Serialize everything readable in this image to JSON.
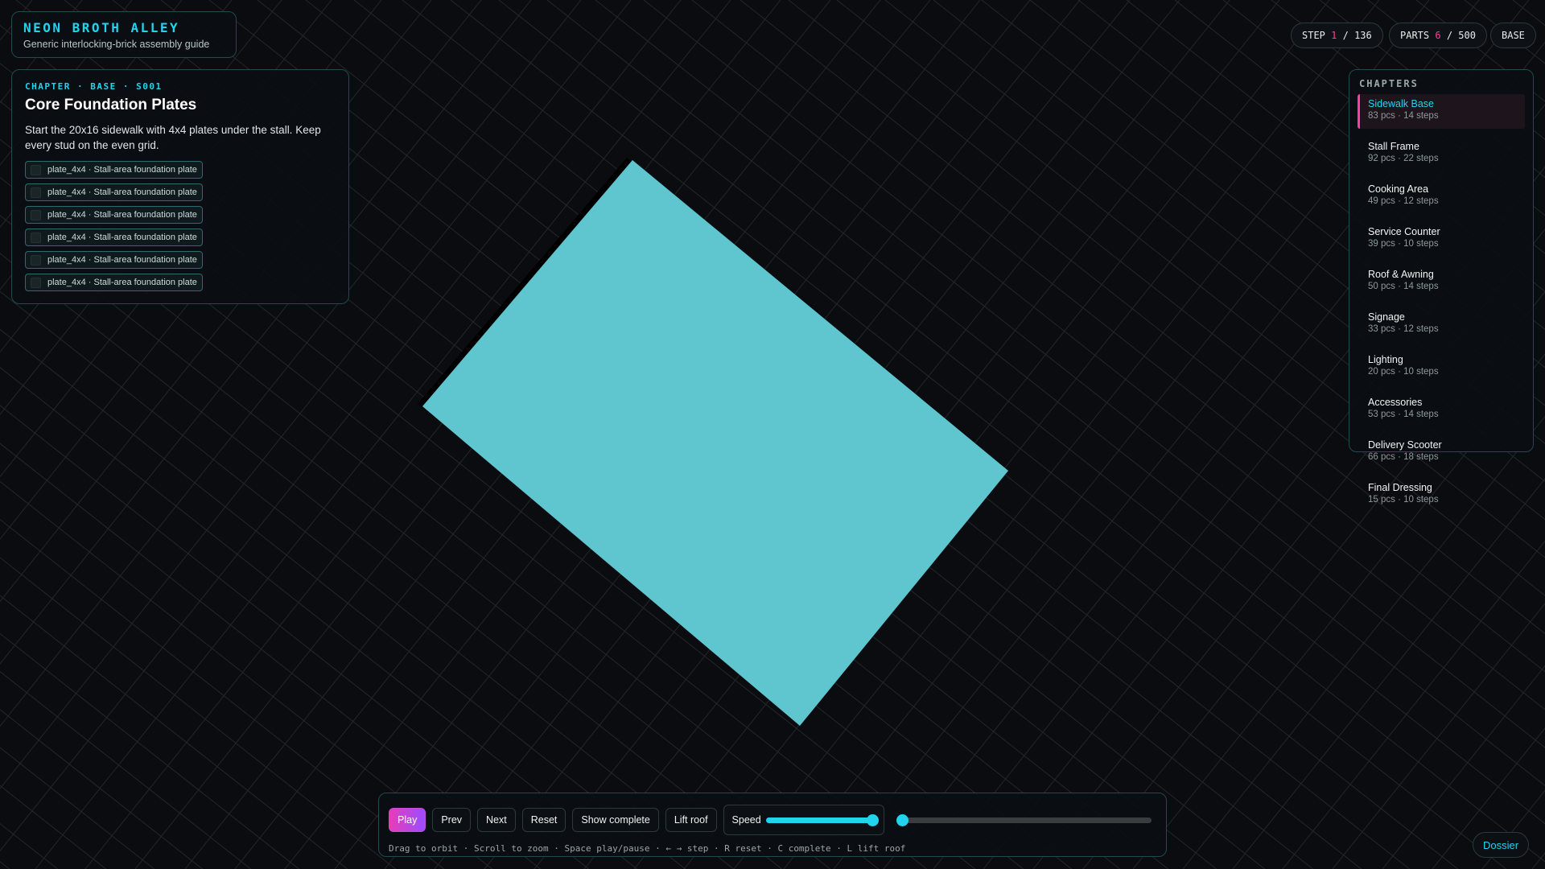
{
  "brand": {
    "title": "NEON BROTH ALLEY",
    "subtitle": "Generic interlocking-brick assembly guide"
  },
  "stats": {
    "step_label": "STEP",
    "step_current": "1",
    "step_sep": "/",
    "step_total": "136",
    "parts_label": "PARTS",
    "parts_current": "6",
    "parts_sep": "/",
    "parts_total": "500",
    "chapter_tag": "BASE"
  },
  "step": {
    "chapter_line": "CHAPTER · BASE · S001",
    "title": "Core Foundation Plates",
    "description": "Start the 20x16 sidewalk with 4x4 plates under the stall. Keep every stud on the even grid.",
    "parts": [
      "plate_4x4 · Stall-area foundation plate",
      "plate_4x4 · Stall-area foundation plate",
      "plate_4x4 · Stall-area foundation plate",
      "plate_4x4 · Stall-area foundation plate",
      "plate_4x4 · Stall-area foundation plate",
      "plate_4x4 · Stall-area foundation plate"
    ]
  },
  "chapters": {
    "heading": "CHAPTERS",
    "items": [
      {
        "name": "Sidewalk Base",
        "meta": "83 pcs · 14 steps",
        "active": true
      },
      {
        "name": "Stall Frame",
        "meta": "92 pcs · 22 steps"
      },
      {
        "name": "Cooking Area",
        "meta": "49 pcs · 12 steps"
      },
      {
        "name": "Service Counter",
        "meta": "39 pcs · 10 steps"
      },
      {
        "name": "Roof & Awning",
        "meta": "50 pcs · 14 steps"
      },
      {
        "name": "Signage",
        "meta": "33 pcs · 12 steps"
      },
      {
        "name": "Lighting",
        "meta": "20 pcs · 10 steps"
      },
      {
        "name": "Accessories",
        "meta": "53 pcs · 14 steps"
      },
      {
        "name": "Delivery Scooter",
        "meta": "66 pcs · 18 steps"
      },
      {
        "name": "Final Dressing",
        "meta": "15 pcs · 10 steps"
      }
    ]
  },
  "controls": {
    "play": "Play",
    "prev": "Prev",
    "next": "Next",
    "reset": "Reset",
    "show_complete": "Show complete",
    "lift_roof": "Lift roof",
    "speed_label": "Speed",
    "speed_fraction": 0.97,
    "timeline_fraction": 0.0,
    "hint": "Drag to orbit · Scroll to zoom · Space play/pause · ← → step · R reset · C complete · L lift roof"
  },
  "dossier": "Dossier",
  "colors": {
    "accent": "#22d3ee",
    "highlight": "#ff3d9a",
    "plate": "#5fc6d0",
    "background": "#0b0c10"
  }
}
